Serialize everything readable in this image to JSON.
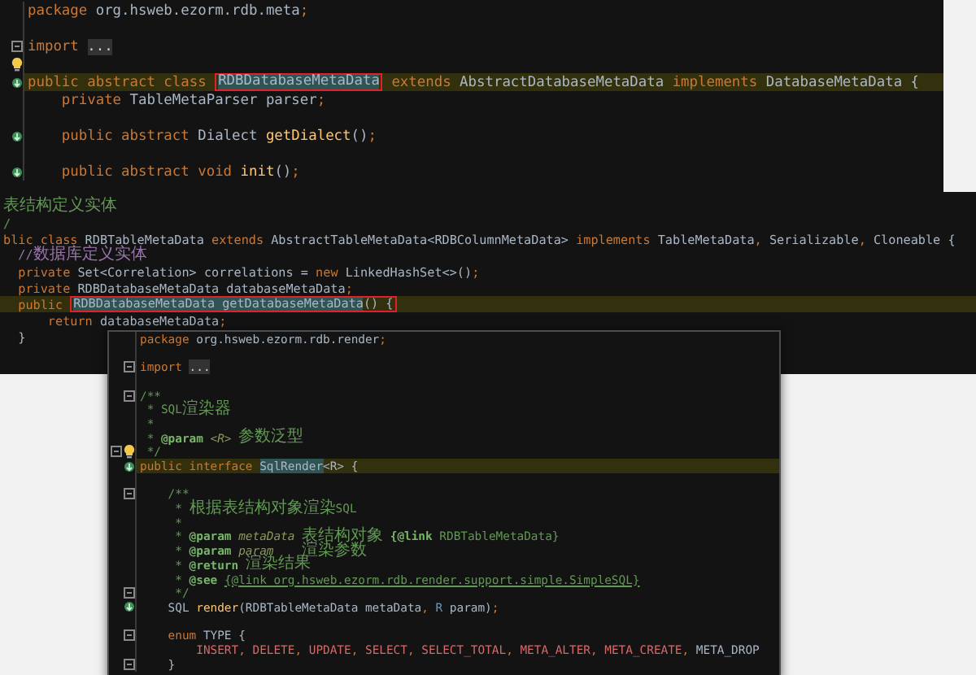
{
  "editors": [
    {
      "lines": [
        {
          "kind": "code",
          "parts": [
            {
              "text": "package ",
              "kind": "kw"
            },
            {
              "text": "org.hsweb.ezorm.rdb.meta",
              "kind": "plain"
            },
            {
              "text": ";",
              "kind": "kw"
            }
          ]
        },
        {
          "kind": "blank"
        },
        {
          "kind": "code",
          "fold": true,
          "parts": [
            {
              "text": "import ",
              "kind": "kw"
            },
            {
              "text": "...",
              "kind": "folded"
            }
          ]
        },
        {
          "kind": "blank",
          "bulb": true
        },
        {
          "kind": "code",
          "override": true,
          "highlighted": true,
          "parts": [
            {
              "text": "public abstract class ",
              "kind": "kw"
            },
            {
              "kind": "box",
              "tokens": [
                {
                  "text": "RDBDatabaseMetaData",
                  "kind": "match"
                }
              ]
            },
            {
              "text": " extends ",
              "kind": "kw"
            },
            {
              "text": "AbstractDatabaseMetaData ",
              "kind": "plain"
            },
            {
              "text": "implements ",
              "kind": "kw"
            },
            {
              "text": "DatabaseMetaData {",
              "kind": "plain"
            }
          ]
        },
        {
          "kind": "code",
          "parts": [
            {
              "text": "    private ",
              "kind": "kw"
            },
            {
              "text": "TableMetaParser parser",
              "kind": "plain"
            },
            {
              "text": ";",
              "kind": "kw"
            }
          ]
        },
        {
          "kind": "blank"
        },
        {
          "kind": "code",
          "override": true,
          "parts": [
            {
              "text": "    public abstract ",
              "kind": "kw"
            },
            {
              "text": "Dialect ",
              "kind": "plain"
            },
            {
              "text": "getDialect",
              "kind": "fn"
            },
            {
              "text": "()",
              "kind": "plain"
            },
            {
              "text": ";",
              "kind": "kw"
            }
          ]
        },
        {
          "kind": "blank"
        },
        {
          "kind": "code",
          "override": true,
          "parts": [
            {
              "text": "    public abstract void ",
              "kind": "kw"
            },
            {
              "text": "init",
              "kind": "fn"
            },
            {
              "text": "()",
              "kind": "plain"
            },
            {
              "text": ";",
              "kind": "kw"
            }
          ]
        }
      ]
    },
    {
      "lines": [
        {
          "kind": "code",
          "parts": [
            {
              "text": "表结构定义实体",
              "kind": "doc"
            }
          ]
        },
        {
          "kind": "code",
          "parts": [
            {
              "text": "/",
              "kind": "doc"
            }
          ]
        },
        {
          "kind": "code",
          "parts": [
            {
              "text": "blic class ",
              "kind": "kw"
            },
            {
              "text": "RDBTableMetaData ",
              "kind": "plain"
            },
            {
              "text": "extends ",
              "kind": "kw"
            },
            {
              "text": "AbstractTableMetaData<RDBColumnMetaData> ",
              "kind": "plain"
            },
            {
              "text": "implements ",
              "kind": "kw"
            },
            {
              "text": "TableMetaData",
              "kind": "plain"
            },
            {
              "text": ", ",
              "kind": "kw"
            },
            {
              "text": "Serializable",
              "kind": "plain"
            },
            {
              "text": ", ",
              "kind": "kw"
            },
            {
              "text": "Cloneable {",
              "kind": "plain"
            }
          ]
        },
        {
          "kind": "code",
          "parts": [
            {
              "text": "  //数据库定义实体",
              "kind": "linecomment"
            }
          ]
        },
        {
          "kind": "code",
          "parts": [
            {
              "text": "  private ",
              "kind": "kw"
            },
            {
              "text": "Set<Correlation> ",
              "kind": "plain"
            },
            {
              "text": "correlations ",
              "kind": "field"
            },
            {
              "text": "= ",
              "kind": "plain"
            },
            {
              "text": "new ",
              "kind": "kw"
            },
            {
              "text": "LinkedHashSet<>()",
              "kind": "plain"
            },
            {
              "text": ";",
              "kind": "kw"
            }
          ]
        },
        {
          "kind": "code",
          "parts": [
            {
              "text": "  private ",
              "kind": "kw"
            },
            {
              "text": "RDBDatabaseMetaData ",
              "kind": "plain"
            },
            {
              "text": "databaseMetaData",
              "kind": "field"
            },
            {
              "text": ";",
              "kind": "kw"
            }
          ]
        },
        {
          "kind": "code",
          "highlighted": true,
          "parts": [
            {
              "text": "  public ",
              "kind": "kw"
            },
            {
              "kind": "box",
              "tokens": [
                {
                  "text": "RDBDatabaseMetaData ",
                  "kind": "match"
                },
                {
                  "text": "getDatabaseMetaData",
                  "kind": "match"
                },
                {
                  "text": "() {",
                  "kind": "plain"
                }
              ]
            }
          ]
        },
        {
          "kind": "code",
          "parts": [
            {
              "text": "      return ",
              "kind": "kw"
            },
            {
              "text": "databaseMetaData",
              "kind": "field"
            },
            {
              "text": ";",
              "kind": "kw"
            }
          ]
        },
        {
          "kind": "code",
          "parts": [
            {
              "text": "  }",
              "kind": "plain"
            }
          ]
        }
      ]
    },
    {
      "lines": [
        {
          "kind": "code",
          "parts": [
            {
              "text": "package ",
              "kind": "kw"
            },
            {
              "text": "org.hsweb.ezorm.rdb.render",
              "kind": "plain"
            },
            {
              "text": ";",
              "kind": "kw"
            }
          ]
        },
        {
          "kind": "blank"
        },
        {
          "kind": "code",
          "fold": true,
          "parts": [
            {
              "text": "import ",
              "kind": "kw"
            },
            {
              "text": "...",
              "kind": "folded"
            }
          ]
        },
        {
          "kind": "blank"
        },
        {
          "kind": "code",
          "fold": true,
          "parts": [
            {
              "text": "/**",
              "kind": "doc"
            }
          ]
        },
        {
          "kind": "code",
          "parts": [
            {
              "text": " * SQL渲染器",
              "kind": "doc"
            }
          ]
        },
        {
          "kind": "code",
          "parts": [
            {
              "text": " *",
              "kind": "doc"
            }
          ]
        },
        {
          "kind": "code",
          "parts": [
            {
              "text": " * ",
              "kind": "doc"
            },
            {
              "text": "@param ",
              "kind": "doctag"
            },
            {
              "text": "<R> ",
              "kind": "docparam"
            },
            {
              "text": "参数泛型",
              "kind": "doc"
            }
          ]
        },
        {
          "kind": "code",
          "fold": true,
          "bulb": true,
          "parts": [
            {
              "text": " */",
              "kind": "doc"
            }
          ]
        },
        {
          "kind": "code",
          "override": true,
          "highlighted": true,
          "parts": [
            {
              "text": "public interface ",
              "kind": "kw"
            },
            {
              "text": "SqlRender",
              "kind": "match"
            },
            {
              "text": "<R> {",
              "kind": "plain"
            }
          ]
        },
        {
          "kind": "blank"
        },
        {
          "kind": "code",
          "fold": true,
          "parts": [
            {
              "text": "    /**",
              "kind": "doc"
            }
          ]
        },
        {
          "kind": "code",
          "parts": [
            {
              "text": "     * 根据表结构对象渲染SQL",
              "kind": "doc"
            }
          ]
        },
        {
          "kind": "code",
          "parts": [
            {
              "text": "     *",
              "kind": "doc"
            }
          ]
        },
        {
          "kind": "code",
          "parts": [
            {
              "text": "     * ",
              "kind": "doc"
            },
            {
              "text": "@param ",
              "kind": "doctag"
            },
            {
              "text": "metaData ",
              "kind": "docparam"
            },
            {
              "text": "表结构对象 ",
              "kind": "doc"
            },
            {
              "text": "{@link ",
              "kind": "doctag"
            },
            {
              "text": "RDBTableMetaData}",
              "kind": "doc"
            }
          ]
        },
        {
          "kind": "code",
          "parts": [
            {
              "text": "     * ",
              "kind": "doc"
            },
            {
              "text": "@param ",
              "kind": "doctag"
            },
            {
              "text": "param    ",
              "kind": "docparam"
            },
            {
              "text": "渲染参数",
              "kind": "doc"
            }
          ]
        },
        {
          "kind": "code",
          "parts": [
            {
              "text": "     * ",
              "kind": "doc"
            },
            {
              "text": "@return ",
              "kind": "doctag"
            },
            {
              "text": "渲染结果",
              "kind": "doc"
            }
          ]
        },
        {
          "kind": "code",
          "parts": [
            {
              "text": "     * ",
              "kind": "doc"
            },
            {
              "text": "@see ",
              "kind": "doctag"
            },
            {
              "text": "{@link org.hsweb.ezorm.rdb.render.support.simple.SimpleSQL}",
              "kind": "link"
            }
          ]
        },
        {
          "kind": "code",
          "fold": true,
          "parts": [
            {
              "text": "     */",
              "kind": "doc"
            }
          ]
        },
        {
          "kind": "code",
          "override": true,
          "parts": [
            {
              "text": "    SQL ",
              "kind": "plain"
            },
            {
              "text": "render",
              "kind": "fn"
            },
            {
              "text": "(RDBTableMetaData metaData",
              "kind": "plain"
            },
            {
              "text": ", ",
              "kind": "kw"
            },
            {
              "text": "R ",
              "kind": "typeparam"
            },
            {
              "text": "param)",
              "kind": "plain"
            },
            {
              "text": ";",
              "kind": "kw"
            }
          ]
        },
        {
          "kind": "blank"
        },
        {
          "kind": "code",
          "fold": true,
          "parts": [
            {
              "text": "    enum ",
              "kind": "kw"
            },
            {
              "text": "TYPE {",
              "kind": "plain"
            }
          ]
        },
        {
          "kind": "code",
          "parts": [
            {
              "text": "        INSERT",
              "kind": "const"
            },
            {
              "text": ", ",
              "kind": "kw"
            },
            {
              "text": "DELETE",
              "kind": "const"
            },
            {
              "text": ", ",
              "kind": "kw"
            },
            {
              "text": "UPDATE",
              "kind": "const"
            },
            {
              "text": ", ",
              "kind": "kw"
            },
            {
              "text": "SELECT",
              "kind": "const"
            },
            {
              "text": ", ",
              "kind": "kw"
            },
            {
              "text": "SELECT_TOTAL",
              "kind": "const"
            },
            {
              "text": ", ",
              "kind": "kw"
            },
            {
              "text": "META_ALTER",
              "kind": "const"
            },
            {
              "text": ", ",
              "kind": "kw"
            },
            {
              "text": "META_CREATE",
              "kind": "const"
            },
            {
              "text": ", ",
              "kind": "kw"
            },
            {
              "text": "META_DROP",
              "kind": "plain"
            }
          ]
        },
        {
          "kind": "code",
          "fold": true,
          "parts": [
            {
              "text": "    }",
              "kind": "plain"
            }
          ]
        }
      ]
    }
  ]
}
